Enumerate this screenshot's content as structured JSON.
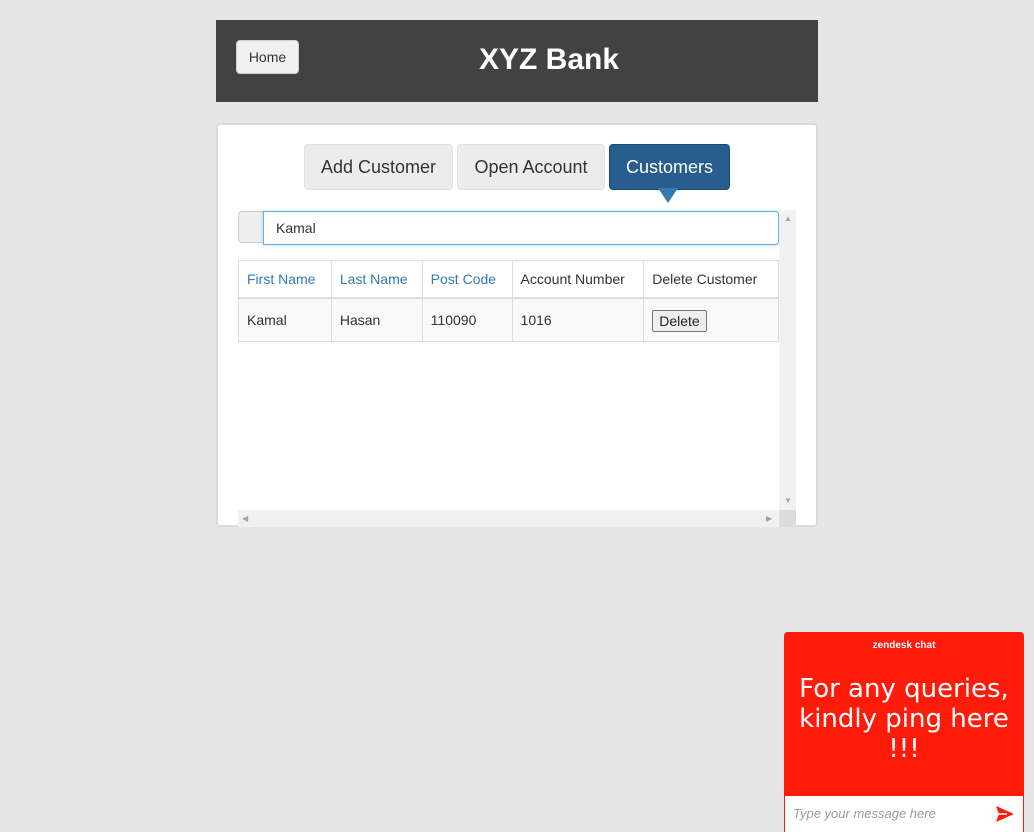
{
  "header": {
    "home_label": "Home",
    "title": "XYZ Bank"
  },
  "tabs": [
    {
      "label": "Add Customer",
      "active": false
    },
    {
      "label": "Open Account",
      "active": false
    },
    {
      "label": "Customers",
      "active": true
    }
  ],
  "search": {
    "value": "Kamal",
    "placeholder": ""
  },
  "table": {
    "columns": [
      "First Name",
      "Last Name",
      "Post Code",
      "Account Number",
      "Delete Customer"
    ],
    "rows": [
      {
        "first_name": "Kamal",
        "last_name": "Hasan",
        "post_code": "110090",
        "account_number": "1016",
        "delete_label": "Delete"
      }
    ]
  },
  "chat": {
    "brand": "zendesk chat",
    "message": "For any queries, kindly ping here !!!",
    "input_placeholder": "Type your message here",
    "color": "#ff1a0a"
  },
  "colors": {
    "header_bg": "#424242",
    "active_tab": "#285e8e",
    "link": "#337ab7",
    "background": "#e6e6e6"
  },
  "icons": {
    "send": "send-icon"
  }
}
